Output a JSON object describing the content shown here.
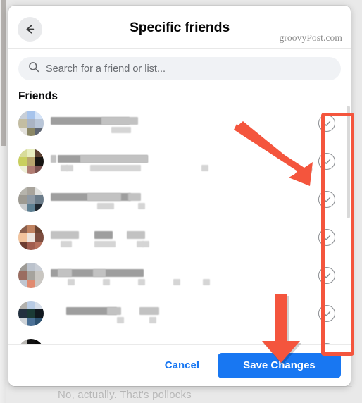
{
  "background": {
    "hidden_text": "No, actually. That's pollocks"
  },
  "dialog": {
    "title": "Specific friends",
    "watermark": "groovyPost.com",
    "back_icon": "arrow-left-icon",
    "search": {
      "placeholder": "Search for a friend or list...",
      "value": "",
      "icon": "search-icon"
    },
    "list": {
      "section_title": "Friends",
      "rows": [
        {
          "name": "",
          "subtitle": "",
          "selected": false
        },
        {
          "name": "",
          "subtitle": "",
          "selected": false
        },
        {
          "name": "",
          "subtitle": "",
          "selected": false
        },
        {
          "name": "",
          "subtitle": "",
          "selected": false
        },
        {
          "name": "",
          "subtitle": "",
          "selected": false
        },
        {
          "name": "",
          "subtitle": "",
          "selected": false
        },
        {
          "name": "",
          "subtitle": "",
          "selected": false
        }
      ]
    },
    "footer": {
      "cancel_label": "Cancel",
      "save_label": "Save Changes"
    }
  },
  "annotations": {
    "highlight_color": "#f4553d",
    "box_target": "checkbox-column",
    "arrows": [
      {
        "name": "arrow-to-checkboxes",
        "direction": "down-right"
      },
      {
        "name": "arrow-to-save-button",
        "direction": "down"
      }
    ]
  },
  "colors": {
    "accent_blue": "#1877f2",
    "annotation_red": "#f4553d",
    "search_bg": "#f0f2f5",
    "text_primary": "#050505"
  }
}
